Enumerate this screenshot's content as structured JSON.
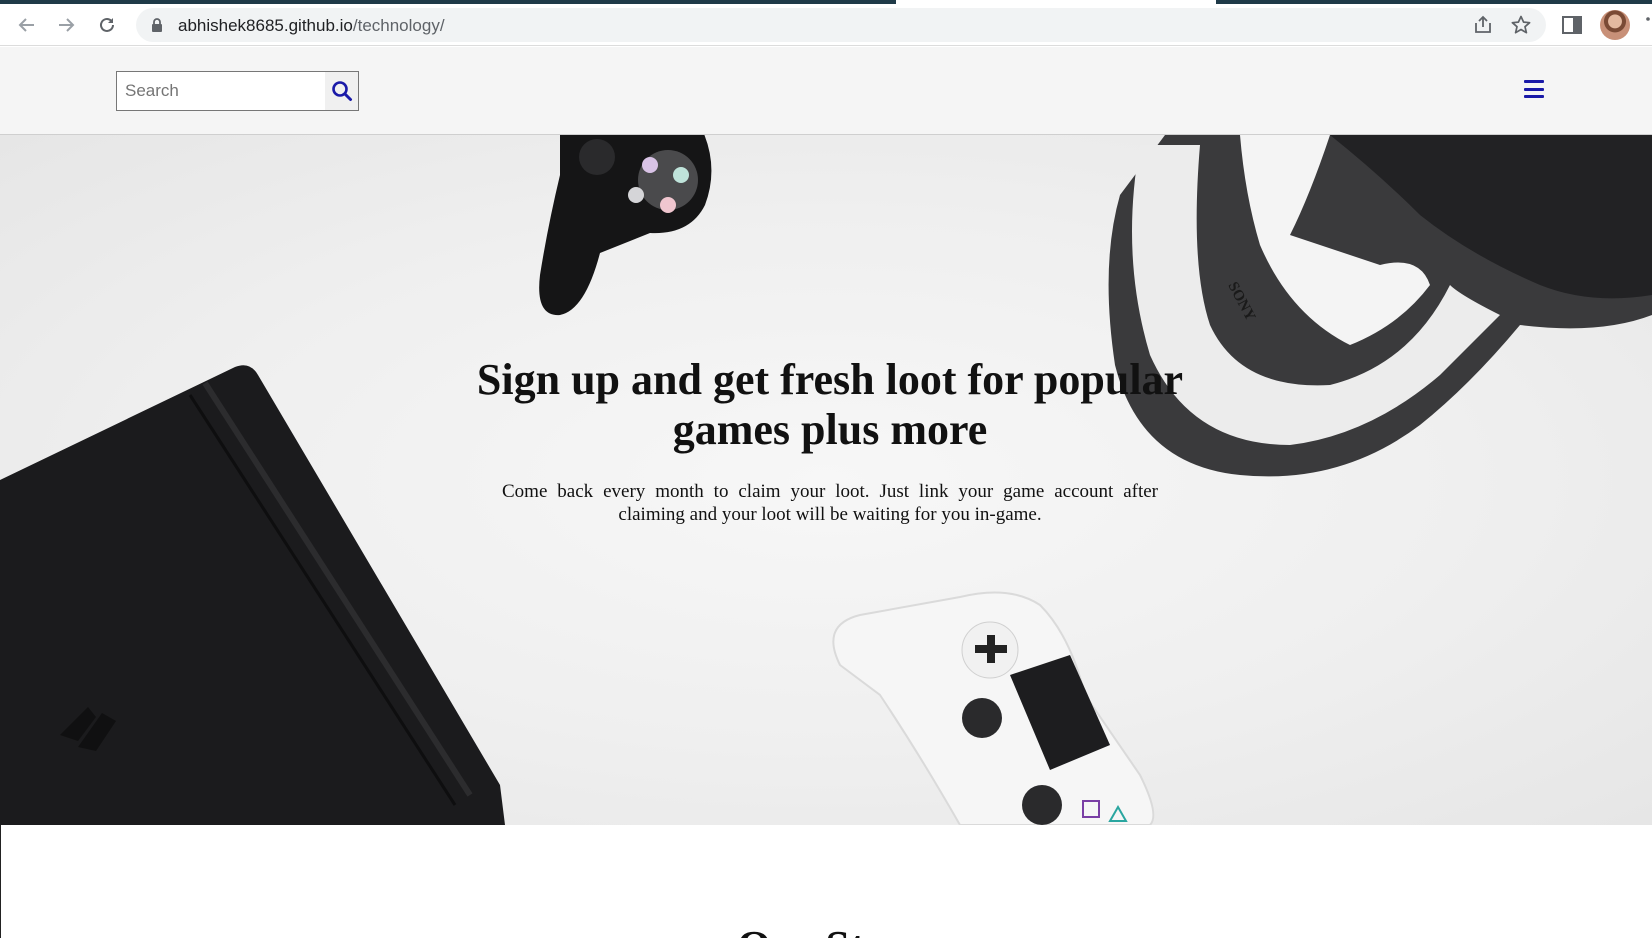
{
  "browser": {
    "url_domain": "abhishek8685.github.io",
    "url_path": "/technology/"
  },
  "icons": {
    "back": "back-arrow-icon",
    "forward": "forward-arrow-icon",
    "reload": "reload-icon",
    "lock": "lock-icon",
    "share": "share-icon",
    "bookmark": "star-icon",
    "side_panel": "side-panel-icon",
    "profile": "avatar",
    "search": "magnifier-icon",
    "menu": "hamburger-icon"
  },
  "header": {
    "search_placeholder": "Search"
  },
  "hero": {
    "title": "Sign up and get fresh loot for popular games plus more",
    "text": "Come back every month to claim your loot. Just link your game account after claiming and your loot will be waiting for you in-game.",
    "console_brand": "SONY"
  },
  "section": {
    "title": "Our St"
  },
  "colors": {
    "accent_icon": "#1a1aa8",
    "header_bg": "#f5f5f5",
    "text": "#111111"
  }
}
